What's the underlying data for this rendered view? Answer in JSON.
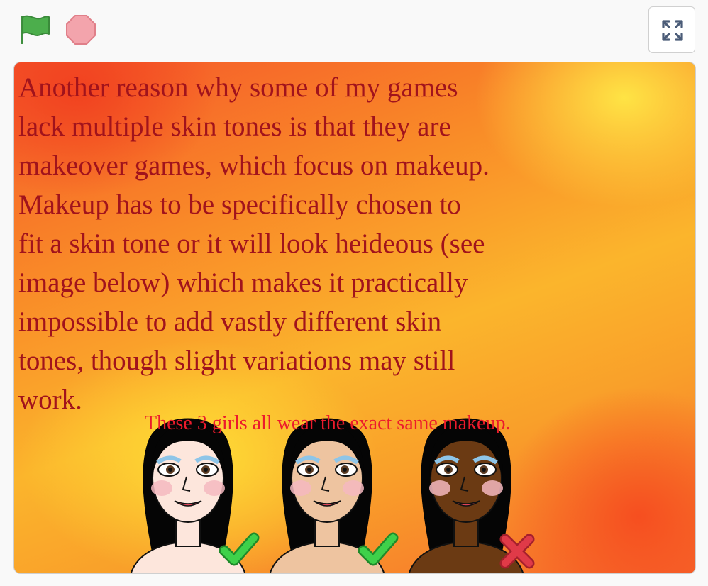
{
  "toolbar": {
    "green_flag": "green-flag-icon",
    "stop": "stop-sign-icon",
    "fullscreen": "fullscreen-icon"
  },
  "stage": {
    "text": "Another reason why some of my games\nlack multiple skin tones is that they are\nmakeover games, which focus on makeup.\nMakeup has to be specifically chosen to\nfit a skin tone or it will look heideous (see\nimage below) which makes it practically\nimpossible to add vastly different skin\ntones, though slight variations may still\nwork.",
    "caption": "These 3 girls all wear the exact same makeup."
  },
  "girls": [
    {
      "skin": "#fde6dc",
      "verdict": "checkmark-icon"
    },
    {
      "skin": "#eec4a0",
      "verdict": "checkmark-icon"
    },
    {
      "skin": "#6b3a13",
      "verdict": "cross-icon"
    }
  ],
  "colors": {
    "text": "#a1131c",
    "caption": "#ec1b2c",
    "flag": "#4cae4c",
    "stop": "#f3a4ac",
    "check": "#3fd14a",
    "cross": "#e03a48"
  }
}
